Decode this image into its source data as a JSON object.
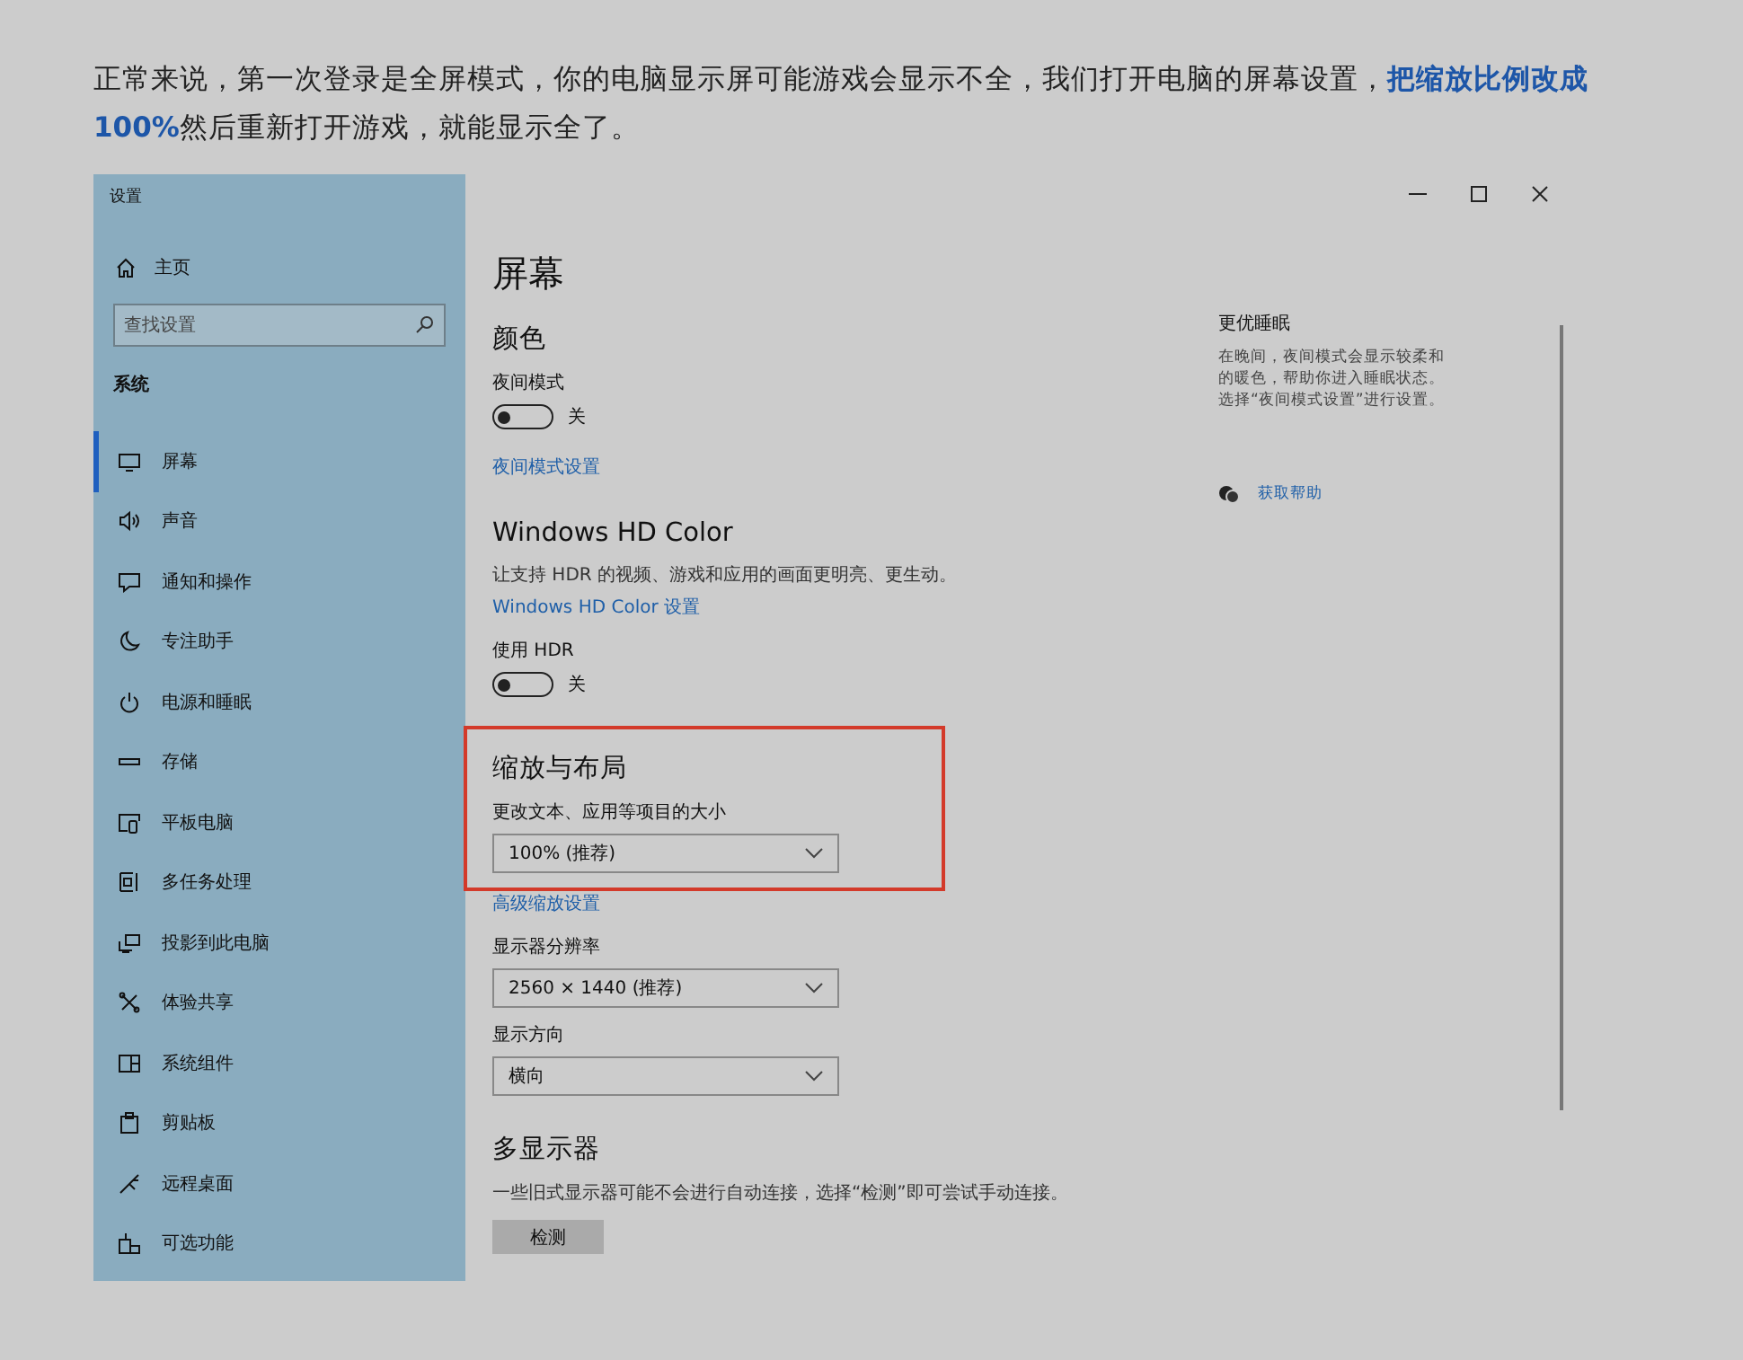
{
  "intro": "正常来说，第一次登录是全屏模式，你的电脑显示屏可能游戏会显示不全，我们打开电脑的屏幕设置，**把缩放比例改成100%**然后重新打开游戏，就能显示全了。",
  "window": {
    "title": "设置"
  },
  "sidebar": {
    "home": "主页",
    "search": {
      "placeholder": "查找设置"
    },
    "section": "系统",
    "items": [
      {
        "label": "屏幕",
        "selected": true
      },
      {
        "label": "声音",
        "selected": false
      },
      {
        "label": "通知和操作",
        "selected": false
      },
      {
        "label": "专注助手",
        "selected": false
      },
      {
        "label": "电源和睡眠",
        "selected": false
      },
      {
        "label": "存储",
        "selected": false
      },
      {
        "label": "平板电脑",
        "selected": false
      },
      {
        "label": "多任务处理",
        "selected": false
      },
      {
        "label": "投影到此电脑",
        "selected": false
      },
      {
        "label": "体验共享",
        "selected": false
      },
      {
        "label": "系统组件",
        "selected": false
      },
      {
        "label": "剪贴板",
        "selected": false
      },
      {
        "label": "远程桌面",
        "selected": false
      },
      {
        "label": "可选功能",
        "selected": false
      }
    ]
  },
  "main": {
    "title": "屏幕",
    "groups": [
      {
        "highlighted": false,
        "items": [
          {
            "kind": "heading",
            "text": "颜色"
          },
          {
            "kind": "label",
            "text": "夜间模式"
          },
          {
            "kind": "toggle",
            "on": false,
            "text": "关"
          },
          {
            "kind": "link",
            "text": "夜间模式设置"
          }
        ]
      },
      {
        "highlighted": false,
        "items": [
          {
            "kind": "heading",
            "text": "Windows HD Color"
          },
          {
            "kind": "text",
            "text": "让支持 HDR 的视频、游戏和应用的画面更明亮、更生动。"
          },
          {
            "kind": "link",
            "text": "Windows HD Color 设置"
          },
          {
            "kind": "label",
            "text": "使用 HDR"
          },
          {
            "kind": "toggle",
            "on": false,
            "text": "关"
          }
        ]
      },
      {
        "highlighted": true,
        "items": [
          {
            "kind": "heading",
            "text": "缩放与布局"
          },
          {
            "kind": "label",
            "text": "更改文本、应用等项目的大小"
          },
          {
            "kind": "dropdown",
            "text": "100% (推荐)"
          }
        ]
      },
      {
        "highlighted": false,
        "items": [
          {
            "kind": "link",
            "text": "高级缩放设置"
          },
          {
            "kind": "label",
            "text": "显示器分辨率"
          },
          {
            "kind": "dropdown",
            "text": "2560 × 1440 (推荐)"
          },
          {
            "kind": "label",
            "text": "显示方向"
          },
          {
            "kind": "dropdown",
            "text": "横向"
          }
        ]
      },
      {
        "highlighted": false,
        "items": [
          {
            "kind": "heading",
            "text": "多显示器"
          },
          {
            "kind": "text",
            "text": "一些旧式显示器可能不会进行自动连接，选择“检测”即可尝试手动连接。"
          },
          {
            "kind": "button",
            "text": "检测"
          }
        ]
      }
    ]
  },
  "side_panel": {
    "title": "更优睡眠",
    "text": "在晚间，夜间模式会显示较柔和的暖色，帮助你进入睡眠状态。选择“夜间模式设置”进行设置。",
    "help": "获取帮助"
  }
}
